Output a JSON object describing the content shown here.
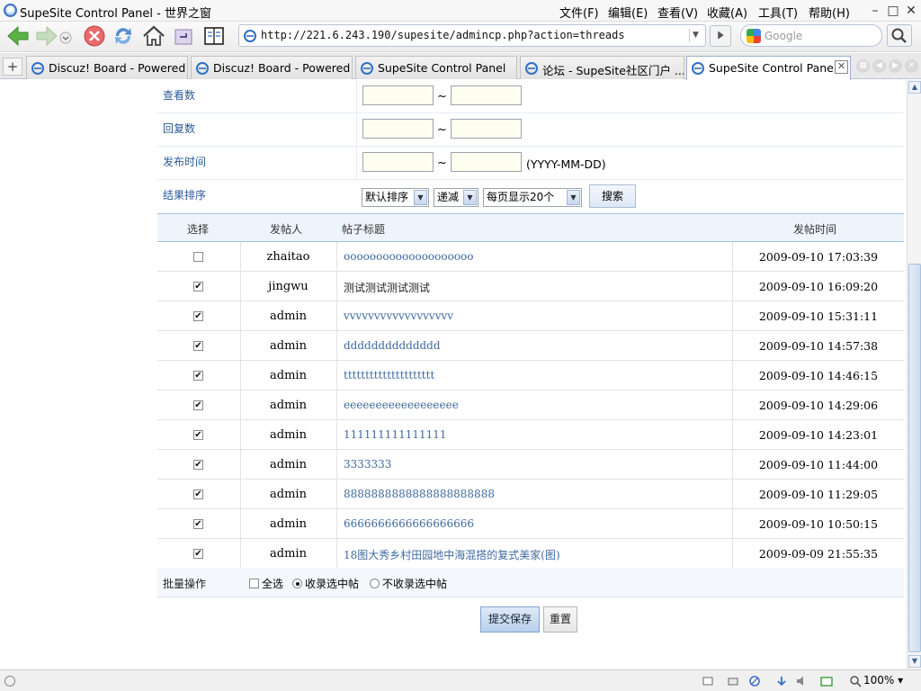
{
  "window": {
    "title": "SupeSite Control Panel - 世界之窗",
    "menu": [
      "文件(F)",
      "编辑(E)",
      "查看(V)",
      "收藏(A)",
      "工具(T)",
      "帮助(H)"
    ]
  },
  "address": {
    "url": "http://221.6.243.190/supesite/admincp.php?action=threads",
    "search_placeholder": "Google"
  },
  "tabs": [
    {
      "label": "Discuz! Board - Powered ..."
    },
    {
      "label": "Discuz! Board - Powered ..."
    },
    {
      "label": "SupeSite Control Panel"
    },
    {
      "label": "论坛 - SupeSite社区门户 ..."
    },
    {
      "label": "SupeSite Control Panel",
      "active": true
    }
  ],
  "filters": {
    "views_label": "查看数",
    "replies_label": "回复数",
    "date_label": "发布时间",
    "date_hint": "(YYYY-MM-DD)",
    "range_sep": "~",
    "sort_label": "结果排序",
    "sort_value": "默认排序",
    "order_value": "递减",
    "perpage_value": "每页显示20个",
    "search_button": "搜索"
  },
  "table": {
    "headers": {
      "select": "选择",
      "author": "发帖人",
      "subject": "帖子标题",
      "time": "发帖时间"
    },
    "rows": [
      {
        "checked": false,
        "author": "zhaitao",
        "subject": "oooooooooooooooooooo",
        "time": "2009-09-10 17:03:39"
      },
      {
        "checked": true,
        "author": "jingwu",
        "subject": "测试测试测试测试",
        "time": "2009-09-10 16:09:20"
      },
      {
        "checked": true,
        "author": "admin",
        "subject": "vvvvvvvvvvvvvvvvvv",
        "time": "2009-09-10 15:31:11"
      },
      {
        "checked": true,
        "author": "admin",
        "subject": "dddddddddddddd",
        "time": "2009-09-10 14:57:38"
      },
      {
        "checked": true,
        "author": "admin",
        "subject": "ttttttttttttttttttttt",
        "time": "2009-09-10 14:46:15"
      },
      {
        "checked": true,
        "author": "admin",
        "subject": "eeeeeeeeeeeeeeeeee",
        "time": "2009-09-10 14:29:06"
      },
      {
        "checked": true,
        "author": "admin",
        "subject": "111111111111111",
        "time": "2009-09-10 14:23:01"
      },
      {
        "checked": true,
        "author": "admin",
        "subject": "3333333",
        "time": "2009-09-10 11:44:00"
      },
      {
        "checked": true,
        "author": "admin",
        "subject": "8888888888888888888888",
        "time": "2009-09-10 11:29:05"
      },
      {
        "checked": true,
        "author": "admin",
        "subject": "6666666666666666666",
        "time": "2009-09-10 10:50:15"
      },
      {
        "checked": true,
        "author": "admin",
        "subject": "18图大秀乡村田园地中海混搭的复式美家(图)",
        "time": "2009-09-09 21:55:35"
      }
    ]
  },
  "batch": {
    "label": "批量操作",
    "select_all": "全选",
    "include_selected": "收录选中帖",
    "exclude_selected": "不收录选中帖"
  },
  "buttons": {
    "submit": "提交保存",
    "reset": "重置"
  },
  "status": {
    "zoom": "100%"
  }
}
